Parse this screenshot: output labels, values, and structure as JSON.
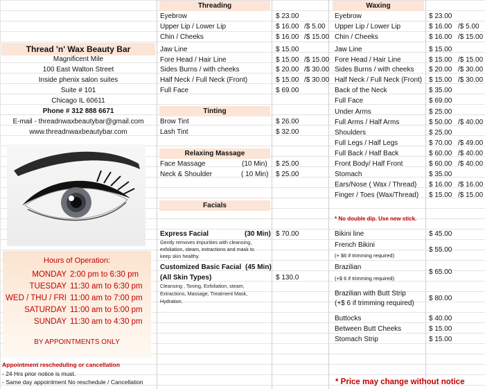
{
  "business": {
    "name": "Thread 'n' Wax Beauty Bar",
    "address_lines": [
      "Magnificent Mile",
      "100  East Walton Street",
      "Inside phenix salon suites",
      "Suite # 101",
      "Chicago IL 60611"
    ],
    "phone": "Phone # 312 888 6671",
    "email": "E-mail - threadnwaxbeautybar@gmail.com",
    "website": "www.threadnwaxbeautybar.com"
  },
  "hours": {
    "title": "Hours of Operation:",
    "rows": [
      {
        "day": "MONDAY",
        "time": "2:00 pm  to  6:30 pm"
      },
      {
        "day": "TUESDAY",
        "time": "11:30 am to 6:30 pm"
      },
      {
        "day": "WED / THU / FRI",
        "time": "11:00 am to 7:00 pm"
      },
      {
        "day": "SATURDAY",
        "time": "11:00 am to 5:00 pm"
      },
      {
        "day": "SUNDAY",
        "time": "11:30 am to 4:30 pm"
      }
    ],
    "note": "BY APPOINTMENTS ONLY"
  },
  "rescheduling": {
    "title": "Appointment rescheduling or cancellation",
    "notes": [
      "- 24 Hrs prior notice is must.",
      "- Same day appointment No reschedule / Cancellation"
    ]
  },
  "threading": {
    "title": "Threading",
    "items": [
      {
        "name": "Eyebrow",
        "price": "$  23.00",
        "alt": ""
      },
      {
        "name": "Upper Lip / Lower Lip",
        "price": "$  16.00",
        "alt": "/$ 5.00"
      },
      {
        "name": "Chin / Cheeks",
        "price": "$  16.00",
        "alt": "/$ 15.00"
      },
      {
        "name": "Jaw Line",
        "price": "$  15.00",
        "alt": ""
      },
      {
        "name": "Fore Head / Hair Line",
        "price": "$  15.00",
        "alt": "/$ 15.00"
      },
      {
        "name": "Sides Burns  /  with cheeks",
        "price": "$  20.00",
        "alt": "/$ 30.00"
      },
      {
        "name": "Half Neck / Full Neck (Front)",
        "price": "$  15.00",
        "alt": "/$ 30.00"
      },
      {
        "name": "Full Face",
        "price": "$  69.00",
        "alt": ""
      }
    ]
  },
  "tinting": {
    "title": "Tinting",
    "items": [
      {
        "name": "Brow Tint",
        "price": "$  26.00"
      },
      {
        "name": "Lash Tint",
        "price": "$  32.00"
      }
    ]
  },
  "massage": {
    "title": "Relaxing Massage",
    "items": [
      {
        "name": "Face Massage",
        "mins": "(10 Min)",
        "price": "$  25.00"
      },
      {
        "name": "Neck & Shoulder",
        "mins": "( 10 Min)",
        "price": "$  25.00"
      }
    ]
  },
  "facials": {
    "title": "Facials",
    "express": {
      "name": "Express  Facial",
      "mins": "(30 Min)",
      "price": "$  70.00",
      "desc": [
        "Gently removes impurities  with cleansing,",
        "exfoliation, steam, extractions  and mask to",
        "keep skin healthy."
      ]
    },
    "custom": {
      "name": "Customized Basic  Facial",
      "mins": "(45 Min)",
      "name2": "(All Skin Types)",
      "price": "$   130.0",
      "desc": [
        "Cleansing , Toning, Exfoliation, steam,",
        "Extractions, Massage, Treatment Mask,",
        "Hydration."
      ]
    }
  },
  "waxing": {
    "title": "Waxing",
    "items": [
      {
        "name": "Eyebrow",
        "price": "$   23.00",
        "alt": ""
      },
      {
        "name": "Upper Lip / Lower Lip",
        "price": "$   16.00",
        "alt": "/$ 5.00"
      },
      {
        "name": "Chin / Cheeks",
        "price": "$   16.00",
        "alt": "/$ 15.00"
      },
      {
        "name": "Jaw Line",
        "price": "$   15.00",
        "alt": ""
      },
      {
        "name": "Fore Head / Hair Line",
        "price": "$   15.00",
        "alt": "/$ 15.00"
      },
      {
        "name": "Sides Burns  /  with cheeks",
        "price": "$   20.00",
        "alt": "/$ 30.00"
      },
      {
        "name": "Half Neck / Full Neck (Front)",
        "price": "$   15.00",
        "alt": "/$ 30.00"
      },
      {
        "name": "Back of the Neck",
        "price": "$   35.00",
        "alt": ""
      },
      {
        "name": "Full Face",
        "price": "$   69.00",
        "alt": ""
      },
      {
        "name": "Under Arms",
        "price": "$   25.00",
        "alt": ""
      },
      {
        "name": "Full Arms / Half Arms",
        "price": "$   50.00",
        "alt": "/$ 40.00"
      },
      {
        "name": "Shoulders",
        "price": "$   25.00",
        "alt": ""
      },
      {
        "name": "Full Legs / Half Legs",
        "price": "$   70.00",
        "alt": "/$ 49.00"
      },
      {
        "name": "Full Back / Half Back",
        "price": "$   60.00",
        "alt": "/$ 40.00"
      },
      {
        "name": "Front Body/ Half Front",
        "price": "$   60.00",
        "alt": "/$ 40.00"
      },
      {
        "name": "Stomach",
        "price": "$   35.00",
        "alt": ""
      },
      {
        "name": "Ears/Nose ( Wax / Thread)",
        "price": "$   16.00",
        "alt": "/$ 16.00"
      },
      {
        "name": "Finger / Toes (Wax/Thread)",
        "price": "$   15.00",
        "alt": "/$ 15.00"
      }
    ],
    "no_double_dip": "* No double dip. Use new stick.",
    "bikini": {
      "name": "Bikini  line",
      "price": "$   45.00"
    },
    "french": {
      "name": "French Bikini",
      "note": "(+ $6 if  trimming required)",
      "price": "$   55.00"
    },
    "brazilian": {
      "name": "Brazilian",
      "note": "(+$ 6 if  trimming required)",
      "price": "$   65.00"
    },
    "brazilian_strip": {
      "name": "Brazilian  with  Butt Strip",
      "note": "(+$ 6 if   trimming required)",
      "price": "$   80.00"
    },
    "tail": [
      {
        "name": "Buttocks",
        "price": "$   40.00"
      },
      {
        "name": " Between Butt  Cheeks",
        "price": "$   15.00"
      },
      {
        "name": "Stomach Strip",
        "price": "$   15.00"
      }
    ],
    "price_note": "* Price may change without notice"
  },
  "colors": {
    "header_bg": "#fce4d6",
    "accent_red": "#c00000"
  }
}
